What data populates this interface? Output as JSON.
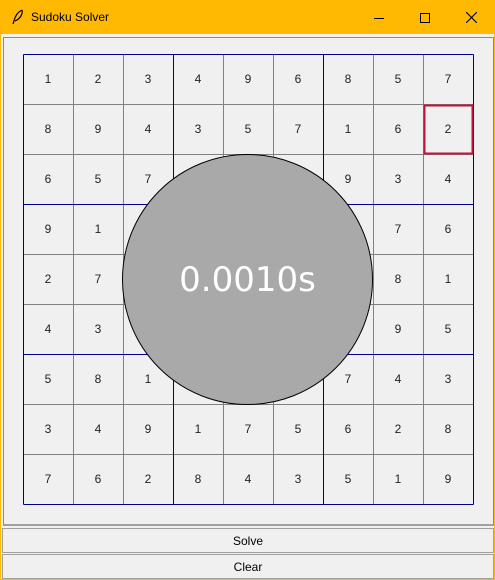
{
  "window": {
    "title": "Sudoku Solver",
    "icon": "feather-icon",
    "controls": [
      "minimize-icon",
      "maximize-icon",
      "close-icon"
    ],
    "titlebar_color": "#ffb900"
  },
  "board": {
    "rows": [
      [
        "1",
        "2",
        "3",
        "4",
        "9",
        "6",
        "8",
        "5",
        "7"
      ],
      [
        "8",
        "9",
        "4",
        "3",
        "5",
        "7",
        "1",
        "6",
        "2"
      ],
      [
        "6",
        "5",
        "7",
        "",
        "",
        "",
        "9",
        "3",
        "4"
      ],
      [
        "9",
        "1",
        "",
        "",
        "",
        "",
        "",
        "7",
        "6"
      ],
      [
        "2",
        "7",
        "",
        "",
        "",
        "",
        "",
        "8",
        "1"
      ],
      [
        "4",
        "3",
        "",
        "",
        "",
        "",
        "",
        "9",
        "5"
      ],
      [
        "5",
        "8",
        "1",
        "",
        "",
        "",
        "7",
        "4",
        "3"
      ],
      [
        "3",
        "4",
        "9",
        "1",
        "7",
        "5",
        "6",
        "2",
        "8"
      ],
      [
        "7",
        "6",
        "2",
        "8",
        "4",
        "3",
        "5",
        "1",
        "9"
      ]
    ],
    "selected_cell": {
      "row": 1,
      "col": 8
    },
    "box_line_color": "#00008b",
    "cell_line_color": "#808080",
    "selected_color": "#c0143c"
  },
  "timer": {
    "text": "0.0010s",
    "fill_color": "#a9a9a9"
  },
  "buttons": {
    "solve": "Solve",
    "clear": "Clear"
  }
}
